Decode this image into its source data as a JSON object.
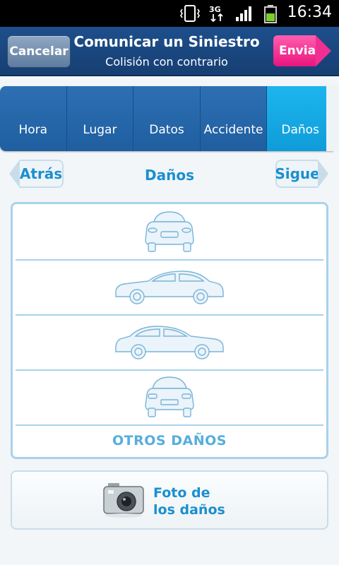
{
  "status_bar": {
    "time": "16:34",
    "icons": [
      "vibrate-icon",
      "data-3g-icon",
      "signal-icon",
      "battery-icon"
    ]
  },
  "header": {
    "cancel_label": "Cancelar",
    "title": "Comunicar un Siniestro",
    "subtitle": "Colisión con contrario",
    "send_label": "Enviar"
  },
  "tabs": [
    {
      "label": "Hora",
      "active": false
    },
    {
      "label": "Lugar",
      "active": false
    },
    {
      "label": "Datos",
      "active": false
    },
    {
      "label": "Accidente",
      "active": false
    },
    {
      "label": "Daños",
      "active": true
    }
  ],
  "nav": {
    "back_label": "Atrás",
    "title": "Daños",
    "next_label": "Sigue"
  },
  "damage_views": [
    {
      "icon": "car-front-icon"
    },
    {
      "icon": "car-side-left-icon"
    },
    {
      "icon": "car-side-right-icon"
    },
    {
      "icon": "car-rear-icon"
    }
  ],
  "other_damages_label": "OTROS DAÑOS",
  "photo": {
    "line1": "Foto de",
    "line2": "los daños",
    "icon": "camera-icon"
  },
  "colors": {
    "accent": "#1a8fd0",
    "header": "#1e4f8c",
    "send": "#f12f92",
    "active_tab": "#1db5ee",
    "outline": "#a9d2ec"
  }
}
